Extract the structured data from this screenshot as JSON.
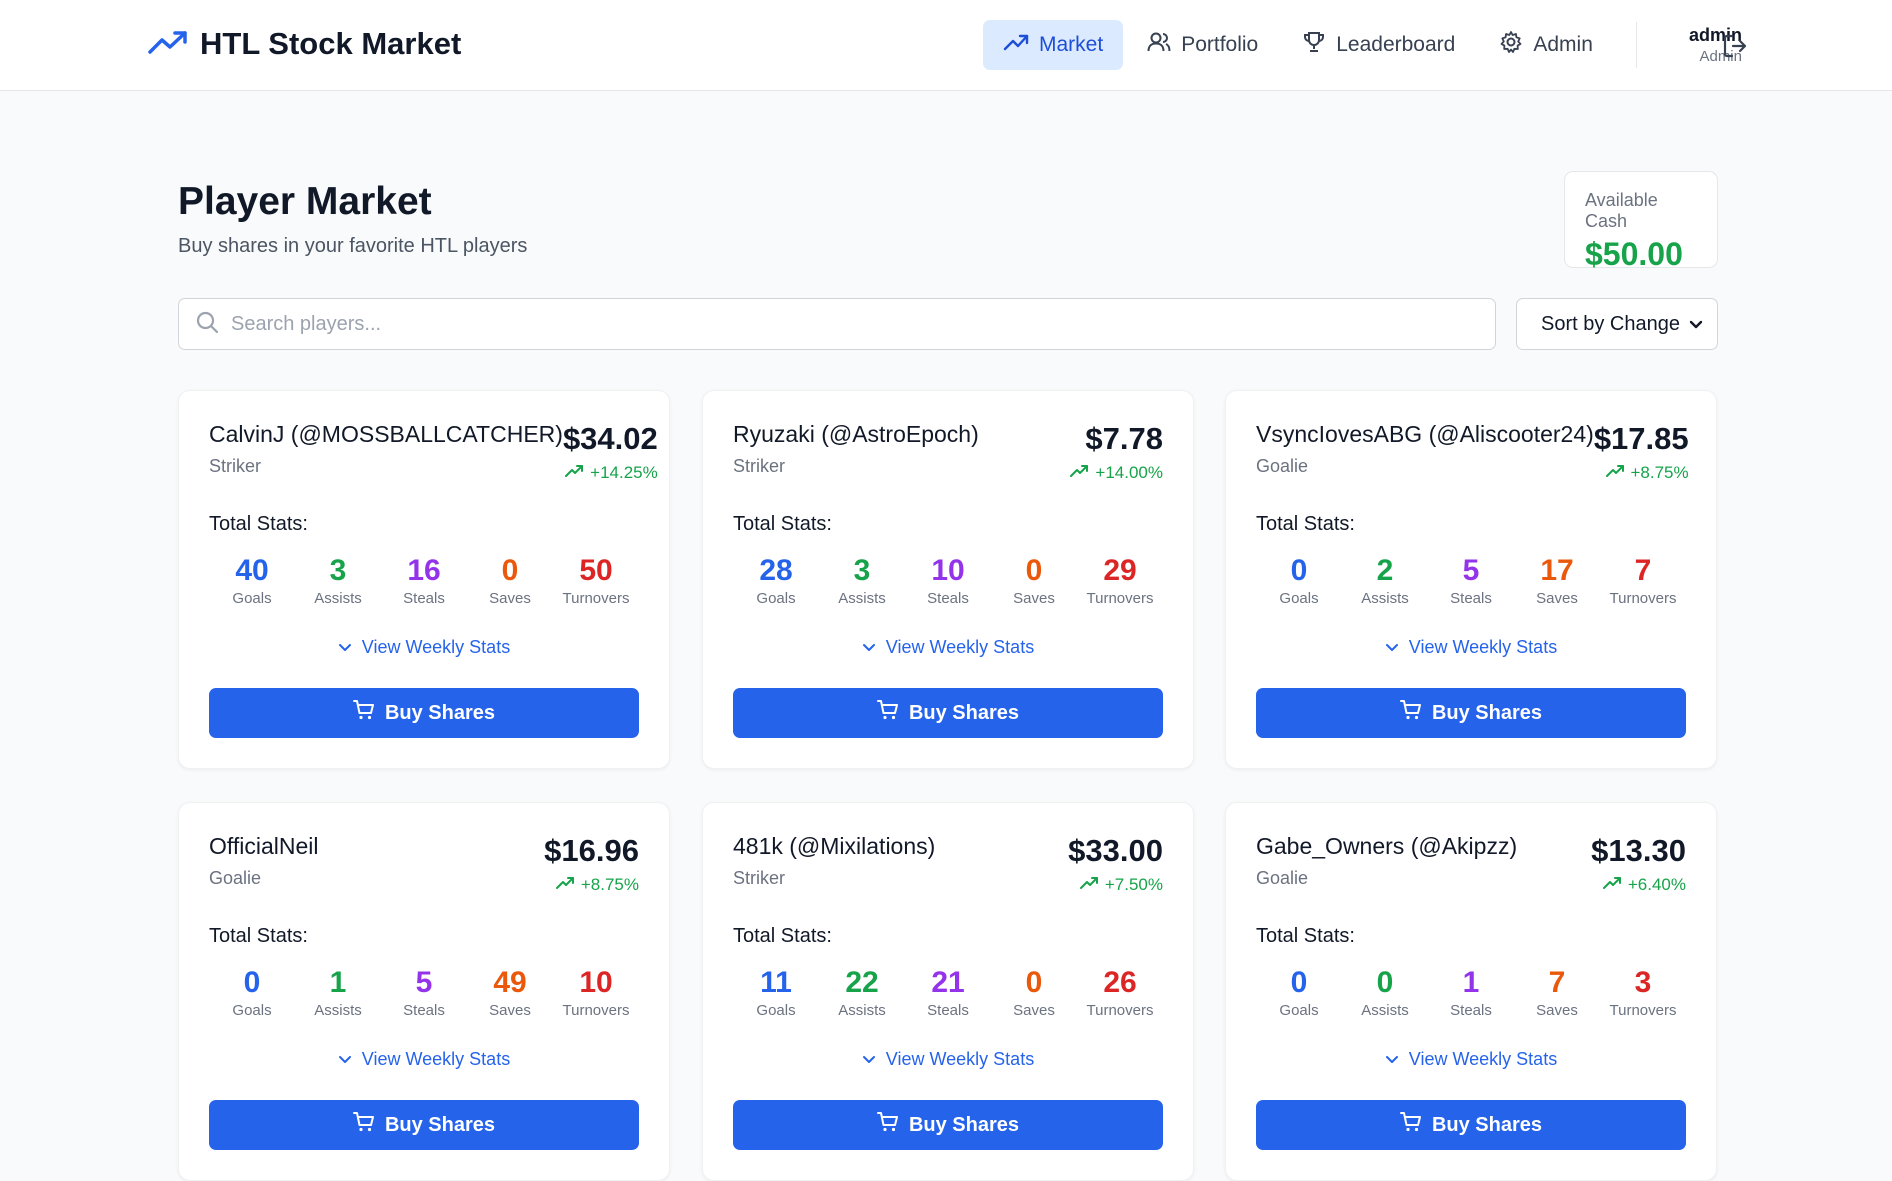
{
  "app": {
    "title": "HTL Stock Market"
  },
  "nav": [
    {
      "label": "Market",
      "icon": "trending-up-icon",
      "active": true
    },
    {
      "label": "Portfolio",
      "icon": "users-icon"
    },
    {
      "label": "Leaderboard",
      "icon": "trophy-icon"
    },
    {
      "label": "Admin",
      "icon": "gear-icon"
    }
  ],
  "user": {
    "name": "admin",
    "role": "Admin"
  },
  "page": {
    "title": "Player Market",
    "subtitle": "Buy shares in your favorite HTL players"
  },
  "cash": {
    "label": "Available Cash",
    "value": "$50.00"
  },
  "search": {
    "placeholder": "Search players..."
  },
  "sort": {
    "selected": "Sort by Change"
  },
  "stat_labels": {
    "goals": "Goals",
    "assists": "Assists",
    "steals": "Steals",
    "saves": "Saves",
    "turnovers": "Turnovers"
  },
  "card_ui": {
    "total_label": "Total Stats:",
    "weekly_label": "View Weekly Stats",
    "buy_label": "Buy Shares"
  },
  "colors": {
    "accent": "#2563eb",
    "positive": "#16a34a",
    "goals": "#2563eb",
    "assists": "#16a34a",
    "steals": "#9333ea",
    "saves": "#ea580c",
    "turnovers": "#dc2626"
  },
  "players": [
    {
      "name": "CalvinJ (@MOSSBALLCATCHER)",
      "position": "Striker",
      "price": "$34.02",
      "change": "+14.25%",
      "goals": "40",
      "assists": "3",
      "steals": "16",
      "saves": "0",
      "turnovers": "50"
    },
    {
      "name": "Ryuzaki (@AstroEpoch)",
      "position": "Striker",
      "price": "$7.78",
      "change": "+14.00%",
      "goals": "28",
      "assists": "3",
      "steals": "10",
      "saves": "0",
      "turnovers": "29"
    },
    {
      "name": "VsyncIovesABG (@Aliscooter24)",
      "position": "Goalie",
      "price": "$17.85",
      "change": "+8.75%",
      "goals": "0",
      "assists": "2",
      "steals": "5",
      "saves": "17",
      "turnovers": "7"
    },
    {
      "name": "OfficialNeil",
      "position": "Goalie",
      "price": "$16.96",
      "change": "+8.75%",
      "goals": "0",
      "assists": "1",
      "steals": "5",
      "saves": "49",
      "turnovers": "10"
    },
    {
      "name": "481k (@Mixilations)",
      "position": "Striker",
      "price": "$33.00",
      "change": "+7.50%",
      "goals": "11",
      "assists": "22",
      "steals": "21",
      "saves": "0",
      "turnovers": "26"
    },
    {
      "name": "Gabe_Owners (@Akipzz)",
      "position": "Goalie",
      "price": "$13.30",
      "change": "+6.40%",
      "goals": "0",
      "assists": "0",
      "steals": "1",
      "saves": "7",
      "turnovers": "3"
    }
  ]
}
